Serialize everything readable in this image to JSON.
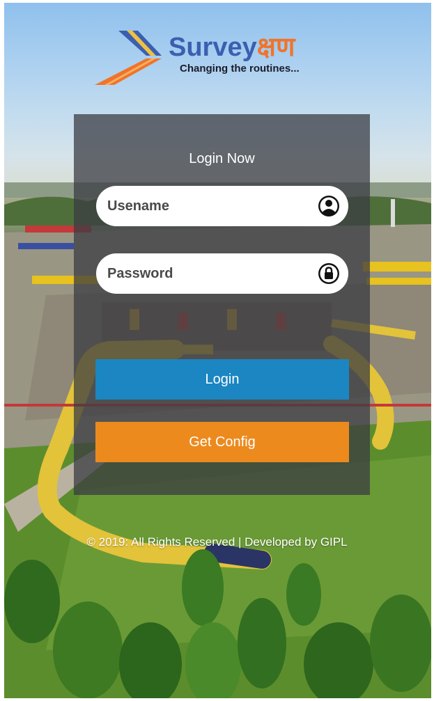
{
  "logo": {
    "brand_latin": "Survey",
    "brand_devanagari": "क्षण",
    "tagline": "Changing the routines..."
  },
  "card": {
    "title": "Login Now",
    "username_placeholder": "Usename",
    "password_placeholder": "Password",
    "login_label": "Login",
    "config_label": "Get Config"
  },
  "footer": {
    "text": "© 2019: All Rights Reserved | Developed by GIPL"
  },
  "colors": {
    "brand_blue": "#3b5fb0",
    "brand_orange": "#f0742a",
    "login_button": "#1b86c1",
    "config_button": "#ec8a1e",
    "card_overlay": "#3a3c42"
  },
  "icons": {
    "username": "user-circle-icon",
    "password": "lock-icon"
  }
}
